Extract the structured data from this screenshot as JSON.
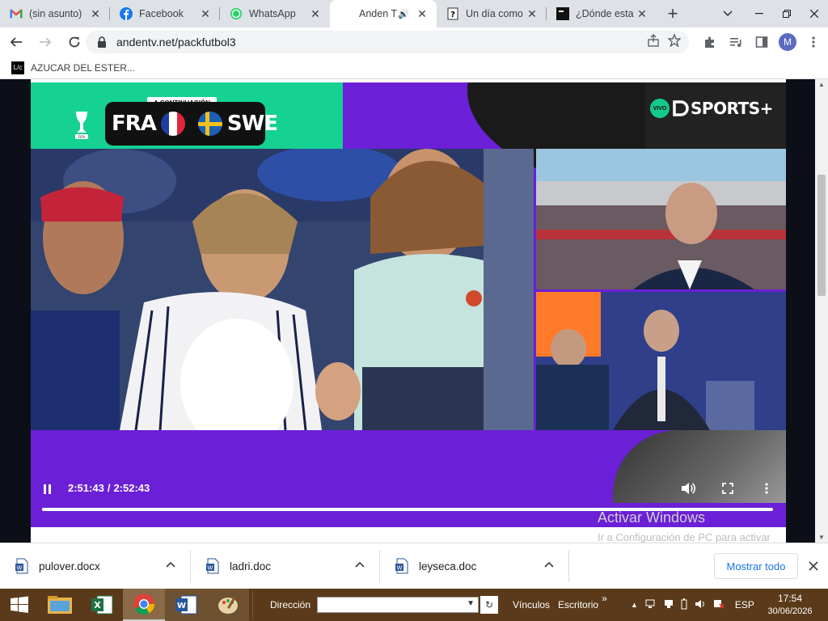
{
  "tabs": [
    {
      "title": "(sin asunto)",
      "icon": "gmail-icon",
      "color": "#ea4335"
    },
    {
      "title": "Facebook",
      "icon": "facebook-icon",
      "color": "#1877f2"
    },
    {
      "title": "WhatsApp",
      "icon": "whatsapp-icon",
      "color": "#25d366"
    },
    {
      "title": "Anden T",
      "icon": "blank",
      "active": true
    },
    {
      "title": "Un día como",
      "icon": "question-page-icon"
    },
    {
      "title": "¿Dónde esta",
      "icon": "black-page-icon"
    }
  ],
  "new_tab_symbol": "+",
  "toolbar": {
    "url": "andentv.net/packfutbol3",
    "profile_initial": "M"
  },
  "bookmarks": [
    {
      "label": "AZUCAR DEL ESTER..."
    }
  ],
  "player": {
    "next_label": "A CONTINUACIÓN",
    "team_home": "FRA",
    "team_away": "SWE",
    "live_badge": "VIVO",
    "brand": "SPORTS+",
    "time_current": "2:51:43",
    "time_separator": "/",
    "time_total": "2:52:43",
    "progress": 0.994
  },
  "watermark": {
    "title": "Activar Windows",
    "subtitle": "Ir a Configuración de PC para activar Windows."
  },
  "downloads": [
    {
      "name": "pulover.docx"
    },
    {
      "name": "ladri.doc"
    },
    {
      "name": "leyseca.doc"
    }
  ],
  "downloads_show_all": "Mostrar todo",
  "taskbar": {
    "address_label": "Dirección",
    "links_label": "Vínculos",
    "desktop_label": "Escritorio",
    "chevron": "»",
    "lang": "ESP",
    "time": "17:54",
    "date": "30/06/2026"
  }
}
